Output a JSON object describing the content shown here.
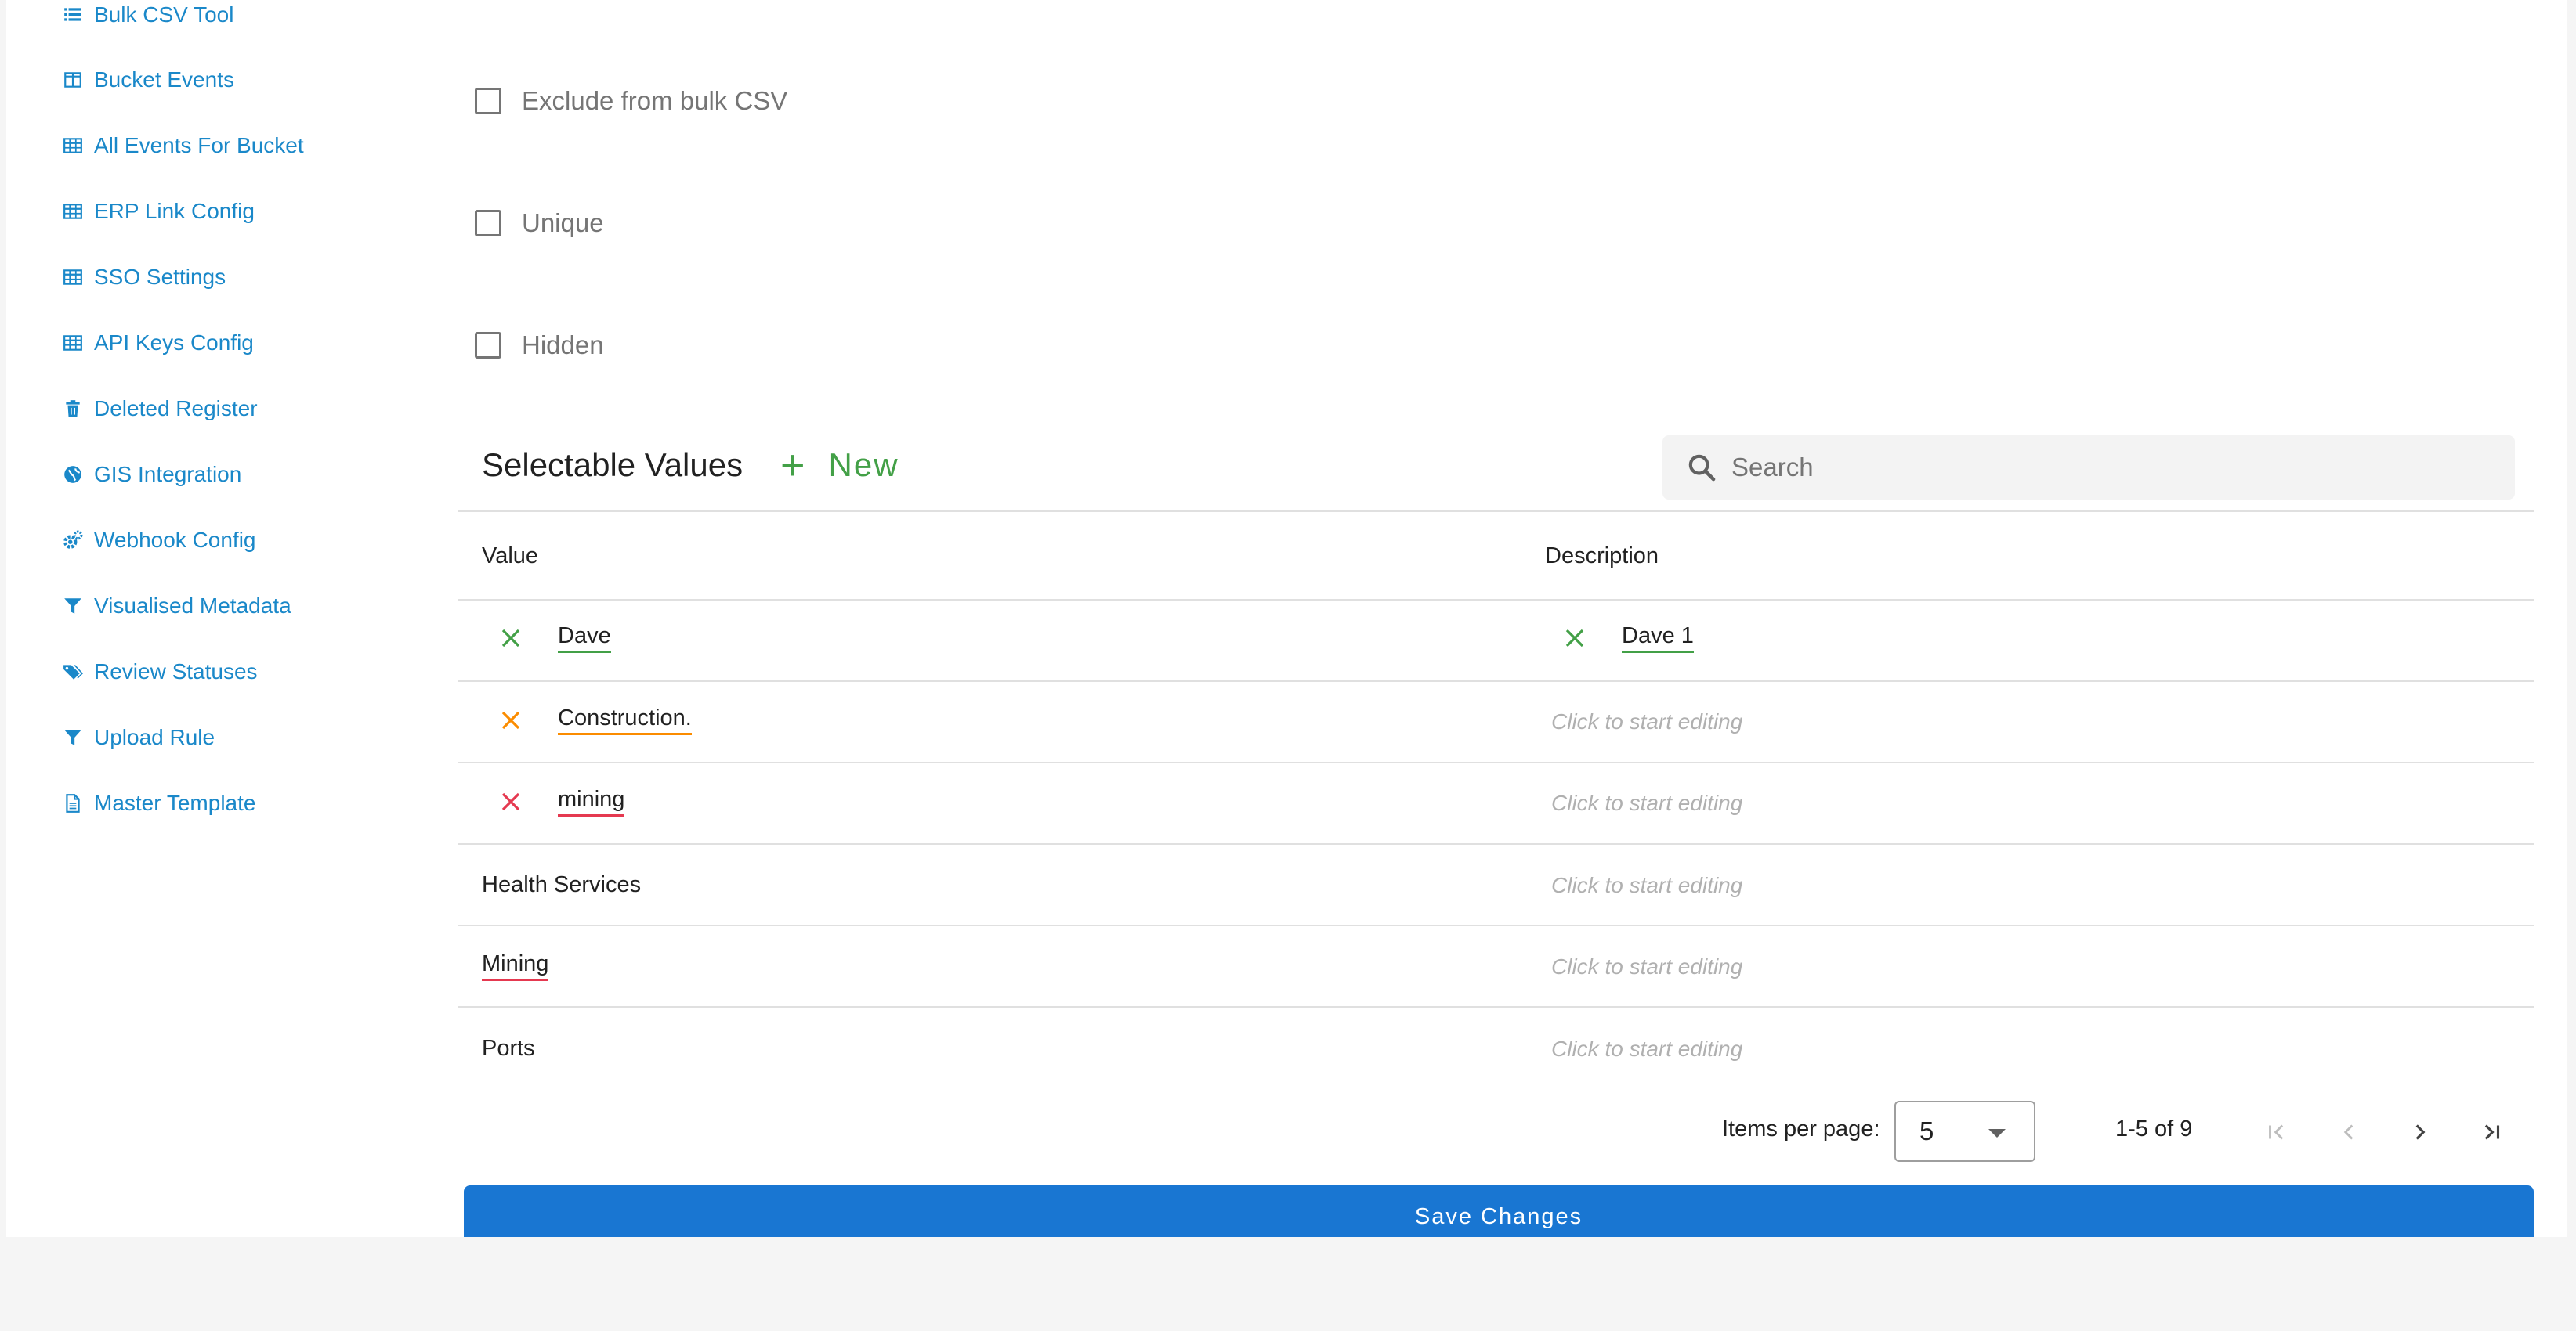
{
  "sidebar": {
    "items": [
      {
        "label": "Bulk CSV Tool",
        "icon": "list-icon"
      },
      {
        "label": "Bucket Events",
        "icon": "columns-icon"
      },
      {
        "label": "All Events For Bucket",
        "icon": "table-icon"
      },
      {
        "label": "ERP Link Config",
        "icon": "table-icon"
      },
      {
        "label": "SSO Settings",
        "icon": "table-icon"
      },
      {
        "label": "API Keys Config",
        "icon": "table-icon"
      },
      {
        "label": "Deleted Register",
        "icon": "trash-icon"
      },
      {
        "label": "GIS Integration",
        "icon": "globe-icon"
      },
      {
        "label": "Webhook Config",
        "icon": "cogs-icon"
      },
      {
        "label": "Visualised Metadata",
        "icon": "filter-icon"
      },
      {
        "label": "Review Statuses",
        "icon": "tags-icon"
      },
      {
        "label": "Upload Rule",
        "icon": "filter-icon"
      },
      {
        "label": "Master Template",
        "icon": "document-icon"
      }
    ]
  },
  "options": {
    "exclude_bulk_csv": {
      "label": "Exclude from bulk CSV",
      "checked": false
    },
    "unique": {
      "label": "Unique",
      "checked": false
    },
    "hidden": {
      "label": "Hidden",
      "checked": false
    }
  },
  "selectable_values": {
    "title": "Selectable Values",
    "new_label": "New",
    "search_placeholder": "Search",
    "columns": {
      "value": "Value",
      "description": "Description"
    },
    "rows": [
      {
        "value": "Dave",
        "description": "Dave 1",
        "value_status": "valid",
        "description_status": "valid"
      },
      {
        "value": "Construction.",
        "description": "Click to start editing",
        "value_status": "warning",
        "description_status": "empty"
      },
      {
        "value": "mining",
        "description": "Click to start editing",
        "value_status": "error",
        "description_status": "empty"
      },
      {
        "value": "Health Services",
        "description": "Click to start editing",
        "value_status": "none",
        "description_status": "empty"
      },
      {
        "value": "Mining",
        "description": "Click to start editing",
        "value_status": "underlined-error",
        "description_status": "empty"
      },
      {
        "value": "Ports",
        "description": "Click to start editing",
        "value_status": "none",
        "description_status": "empty"
      }
    ]
  },
  "paginator": {
    "items_per_page_label": "Items per page:",
    "items_per_page": "5",
    "range": "1-5 of 9"
  },
  "save_label": "Save Changes",
  "colors": {
    "link": "#1a88c9",
    "success": "#43a047",
    "warning": "#fb8c00",
    "error": "#e53950",
    "primary": "#1976d2"
  }
}
